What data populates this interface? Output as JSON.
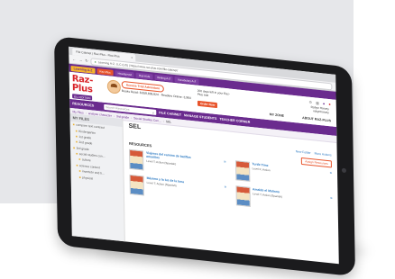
{
  "browser": {
    "tab_title": "File Cabinet | Raz-Plus - Raz-Plus",
    "tab_close": "×",
    "url": "Learning A-Z, LLC (US) | https://www.raz-plus.com/file-cabinet/"
  },
  "nav": {
    "brand": "Learning A-Z",
    "tabs": [
      "Raz-Plus",
      "Headsprout",
      "Raz-Kids",
      "Writing A-Z",
      "Vocabulary A-Z"
    ]
  },
  "header": {
    "logo_text": "Raz-Plus",
    "logo_edition": "ELL EDITION",
    "trial_pill": "Access Trial Adventure",
    "stats": "Books Read: 8,658,836,824  ·  Readers Online: 3,964",
    "days_left": "200 days left in your Raz-Plus trial",
    "order_now": "Order Now",
    "user_name": "Robyn Harvey",
    "user_school": "robynharvey",
    "my_zone": "MY ZONE",
    "about": "ABOUT RAZ-PLUS"
  },
  "toolbar": {
    "resources": "RESOURCES",
    "search_placeholder": "Search Resources",
    "file_cabinet": "FILE CABINET",
    "manage_students": "MANAGE STUDENTS",
    "teacher_corner": "TEACHER CORNER"
  },
  "breadcrumb": [
    "My Files",
    "analyze character",
    "3rd grade",
    "Social Studies Con...",
    "SEL"
  ],
  "sidebar": {
    "title": "MY FILES",
    "folders": [
      "compare text contrast",
      "Kindergarten",
      "1st grade",
      "2nd grade",
      "3rd grade",
      "social studies con...",
      "culture",
      "science content",
      "invertebr and ti...",
      "physical"
    ]
  },
  "main": {
    "title": "SEL",
    "new_folder": "New Folder",
    "more_actions": "More Actions",
    "resources_heading": "RESOURCES",
    "assign": "Assign Resources",
    "cards": [
      {
        "title": "Viajeros del camino de batiflos amarillos",
        "level": "Level T; Action (Spanish)"
      },
      {
        "title": "Turtle Time",
        "level": "Level K; Action"
      },
      {
        "title": "Máximo y la luz de la luna",
        "level": "Level T; Action (Spanish)"
      },
      {
        "title": "Amaldo el Malinno",
        "level": "Level T; Action (Spanish)"
      }
    ]
  }
}
